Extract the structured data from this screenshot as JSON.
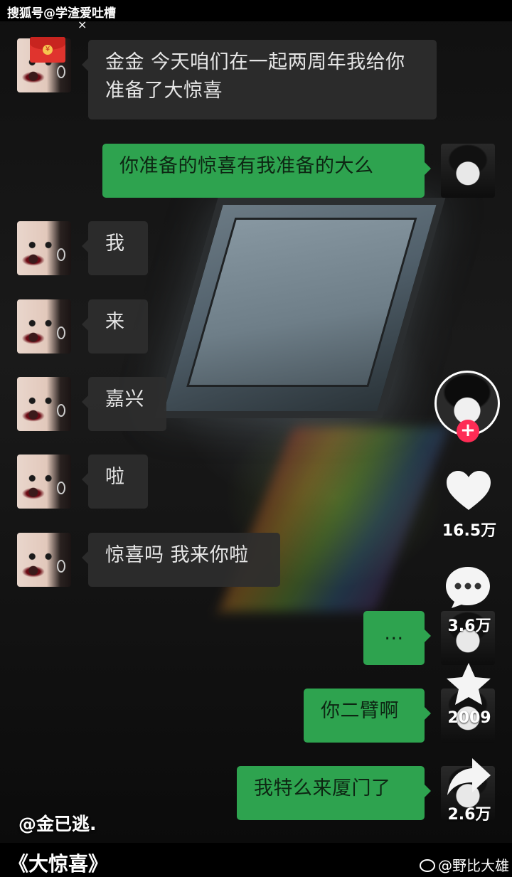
{
  "watermark_top": "搜狐号@学渣爱吐槽",
  "close_symbol": "×",
  "red_packet_symbol": "¥",
  "messages": [
    {
      "side": "left",
      "text": "金金 今天咱们在一起两周年我给你准备了大惊喜"
    },
    {
      "side": "right",
      "text": "你准备的惊喜有我准备的大么"
    },
    {
      "side": "left",
      "text": "我"
    },
    {
      "side": "left",
      "text": "来"
    },
    {
      "side": "left",
      "text": "嘉兴"
    },
    {
      "side": "left",
      "text": "啦"
    },
    {
      "side": "left",
      "text": "惊喜吗 我来你啦"
    },
    {
      "side": "right",
      "text": "..."
    },
    {
      "side": "right",
      "text": "你二臂啊"
    },
    {
      "side": "right",
      "text": "我特么来厦门了"
    }
  ],
  "sidebar": {
    "follow": "+",
    "likes": "16.5万",
    "comments": "3.6万",
    "favorites": "2009",
    "shares": "2.6万"
  },
  "username": "@金已逃.",
  "caption": "《大惊喜》",
  "weibo_handle": "@野比大雄",
  "icons": [
    "close-icon",
    "red-packet-icon",
    "heart-icon",
    "comment-icon",
    "star-icon",
    "share-icon",
    "weibo-logo-icon"
  ],
  "colors": {
    "green_bubble": "#2ea34f",
    "gray_bubble": "#2e2e2e",
    "follow_red": "#fe2c55"
  }
}
